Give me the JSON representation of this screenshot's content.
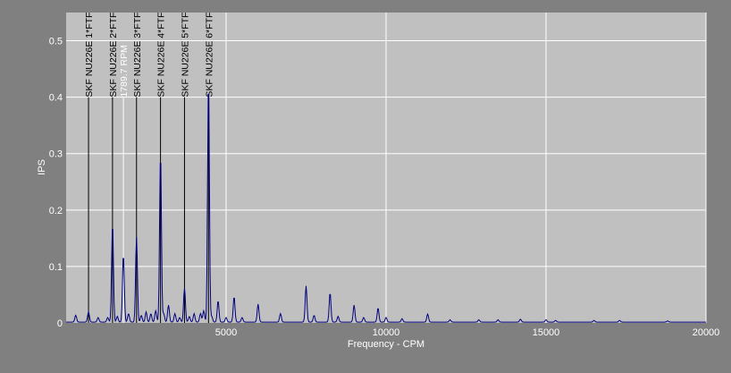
{
  "chart_data": {
    "type": "line",
    "xlabel": "Frequency - CPM",
    "ylabel": "IPS",
    "xlim": [
      0,
      20000
    ],
    "ylim": [
      0,
      0.55
    ],
    "x_ticks": [
      5000,
      10000,
      15000,
      20000
    ],
    "y_ticks": [
      0,
      0.1,
      0.2,
      0.3,
      0.4,
      0.5
    ],
    "grid": true,
    "colors": {
      "background": "#808080",
      "plot_area": "#c0c0c0",
      "grid": "#ffffff",
      "series": "#00007f",
      "marker": "#000000",
      "rpm_marker": "#ffffff"
    },
    "markers": [
      {
        "label": "SKF NU226E 1*FTF",
        "x": 700,
        "color": "#000000"
      },
      {
        "label": "SKF NU226E 2*FTF",
        "x": 1450,
        "color": "#000000"
      },
      {
        "label": "1789.7 RPM",
        "x": 1790,
        "color": "#ffffff"
      },
      {
        "label": "SKF NU226E 3*FTF",
        "x": 2200,
        "color": "#000000"
      },
      {
        "label": "SKF NU226E 4*FTF",
        "x": 2950,
        "color": "#000000"
      },
      {
        "label": "SKF NU226E 5*FTF",
        "x": 3700,
        "color": "#000000"
      },
      {
        "label": "SKF NU226E 6*FTF",
        "x": 4450,
        "color": "#000000"
      }
    ],
    "series": [
      {
        "peaks": [
          [
            300,
            0.012
          ],
          [
            700,
            0.018
          ],
          [
            1000,
            0.008
          ],
          [
            1300,
            0.008
          ],
          [
            1450,
            0.175
          ],
          [
            1600,
            0.01
          ],
          [
            1790,
            0.12
          ],
          [
            1950,
            0.015
          ],
          [
            2200,
            0.15
          ],
          [
            2350,
            0.012
          ],
          [
            2500,
            0.018
          ],
          [
            2650,
            0.015
          ],
          [
            2800,
            0.02
          ],
          [
            2950,
            0.3
          ],
          [
            3050,
            0.015
          ],
          [
            3200,
            0.03
          ],
          [
            3400,
            0.015
          ],
          [
            3550,
            0.008
          ],
          [
            3700,
            0.06
          ],
          [
            3850,
            0.01
          ],
          [
            4000,
            0.015
          ],
          [
            4200,
            0.015
          ],
          [
            4300,
            0.02
          ],
          [
            4450,
            0.43
          ],
          [
            4550,
            0.01
          ],
          [
            4750,
            0.038
          ],
          [
            5000,
            0.008
          ],
          [
            5250,
            0.045
          ],
          [
            5500,
            0.008
          ],
          [
            6000,
            0.032
          ],
          [
            6700,
            0.015
          ],
          [
            7500,
            0.064
          ],
          [
            7750,
            0.012
          ],
          [
            8250,
            0.052
          ],
          [
            8500,
            0.01
          ],
          [
            9000,
            0.03
          ],
          [
            9300,
            0.008
          ],
          [
            9750,
            0.025
          ],
          [
            10000,
            0.008
          ],
          [
            10500,
            0.006
          ],
          [
            11300,
            0.014
          ],
          [
            12000,
            0.004
          ],
          [
            12900,
            0.004
          ],
          [
            13500,
            0.004
          ],
          [
            14200,
            0.005
          ],
          [
            15000,
            0.004
          ],
          [
            15300,
            0.003
          ],
          [
            16500,
            0.003
          ],
          [
            17300,
            0.003
          ],
          [
            18800,
            0.002
          ]
        ]
      }
    ]
  }
}
